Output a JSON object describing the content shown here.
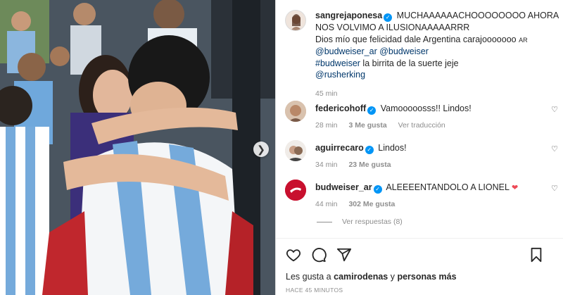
{
  "post": {
    "author": "sangrejaponesa",
    "caption_line1": "MUCHAAAAAACHOOOOOOOO AHORA NOS VOLVIMO A ILUSIONAAAAARRR",
    "caption_line2": "Dios mío que felicidad dale Argentina carajooooooo",
    "caption_ar": "AR",
    "mention1": "@budweiser_ar",
    "mention2": "@budweiser",
    "hashtag": "#budweiser",
    "caption_line4": "la birrita de la suerte jeje",
    "mention3": "@rusherking",
    "time": "45 min"
  },
  "comments": [
    {
      "user": "federicohoff",
      "text": "Vamooooosss!! Lindos!",
      "time": "28 min",
      "likes": "3 Me gusta",
      "translate": "Ver traducción"
    },
    {
      "user": "aguirrecaro",
      "text": "Lindos!",
      "time": "34 min",
      "likes": "23 Me gusta"
    },
    {
      "user": "budweiser_ar",
      "text": "ALEEEENTANDOLO A LIONEL",
      "heart": "❤",
      "time": "44 min",
      "likes": "302 Me gusta"
    }
  ],
  "replies_label": "Ver respuestas (8)",
  "likes": {
    "prefix": "Les gusta a",
    "user": "camirodenas",
    "middle": "y",
    "others": "personas más"
  },
  "posted": "HACE 45 MINUTOS",
  "icons": [
    "heart-icon",
    "comment-icon",
    "share-icon",
    "bookmark-icon",
    "chevron-right-icon",
    "verified-icon"
  ],
  "colors": {
    "verified": "#0095f6",
    "link": "#00376b",
    "meta": "#8e8e8e",
    "heart_red": "#ed4956",
    "budweiser_red": "#c8102e"
  }
}
